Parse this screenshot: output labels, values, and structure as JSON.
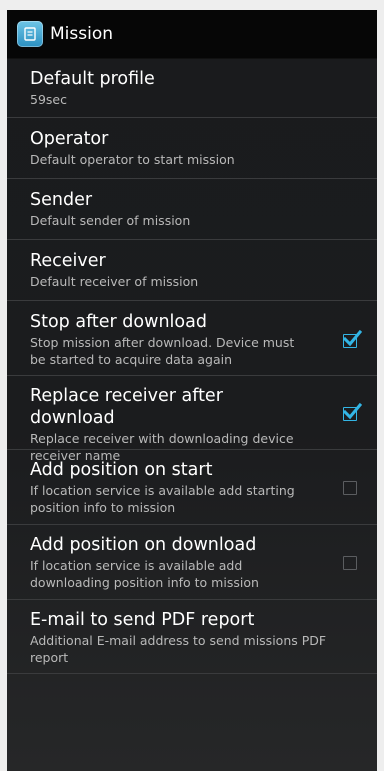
{
  "header": {
    "title": "Mission",
    "icon": "mission-app-icon"
  },
  "items": [
    {
      "title": "Default profile",
      "summary": "59sec"
    },
    {
      "title": "Operator",
      "summary": "Default operator to start mission"
    },
    {
      "title": "Sender",
      "summary": "Default sender of mission"
    },
    {
      "title": "Receiver",
      "summary": "Default receiver of mission"
    },
    {
      "title": "Stop after download",
      "summary": "Stop mission after download. Device must be started to acquire data again",
      "checked": true
    },
    {
      "title": "Replace receiver after download",
      "summary": "Replace receiver with downloading device receiver name",
      "checked": true
    },
    {
      "title": "Add position on start",
      "summary": "If location service is available add starting position info to mission",
      "checked": false
    },
    {
      "title": "Add position on download",
      "summary": "If location service is available add downloading position info to mission",
      "checked": false
    },
    {
      "title": "E-mail to send PDF report",
      "summary": "Additional E-mail address to send missions PDF report"
    }
  ],
  "colors": {
    "accent": "#33b5e5",
    "background": "#1b1c1e",
    "actionbar": "#060606"
  }
}
